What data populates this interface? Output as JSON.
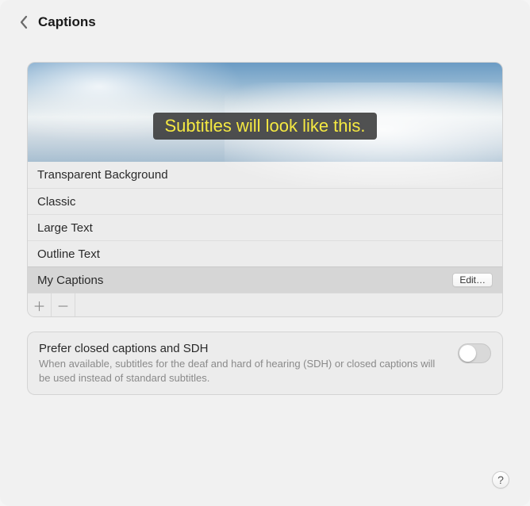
{
  "header": {
    "title": "Captions"
  },
  "preview": {
    "sample_text": "Subtitles will look like this."
  },
  "styles": [
    {
      "label": "Transparent Background",
      "selected": false
    },
    {
      "label": "Classic",
      "selected": false
    },
    {
      "label": "Large Text",
      "selected": false
    },
    {
      "label": "Outline Text",
      "selected": false
    },
    {
      "label": "My Captions",
      "selected": true
    }
  ],
  "edit_button_label": "Edit…",
  "addremove": {
    "add_icon": "＋",
    "remove_icon": "－"
  },
  "prefer": {
    "title": "Prefer closed captions and SDH",
    "description": "When available, subtitles for the deaf and hard of hearing (SDH) or closed captions will be used instead of standard subtitles.",
    "enabled": false
  },
  "help_label": "?"
}
